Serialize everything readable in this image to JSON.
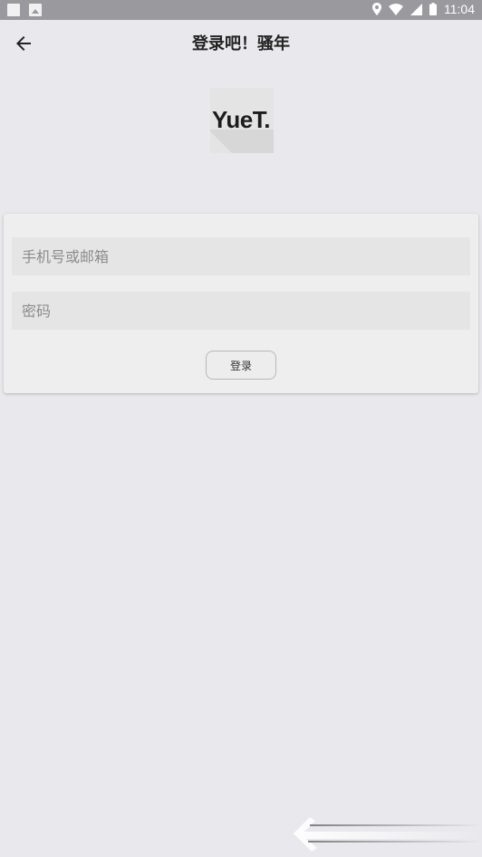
{
  "status_bar": {
    "time": "11:04",
    "icons": [
      "location-icon",
      "wifi-icon",
      "signal-icon",
      "battery-icon"
    ]
  },
  "app_bar": {
    "title": "登录吧！骚年",
    "back_icon": "arrow-left-icon"
  },
  "logo": {
    "text": "YueT."
  },
  "form": {
    "username_placeholder": "手机号或邮箱",
    "username_value": "",
    "password_placeholder": "密码",
    "password_value": "",
    "login_label": "登录"
  },
  "colors": {
    "background": "#e9e8ec",
    "status_bar": "#9a999d",
    "card": "#eeeeee",
    "field": "#e5e5e5"
  }
}
